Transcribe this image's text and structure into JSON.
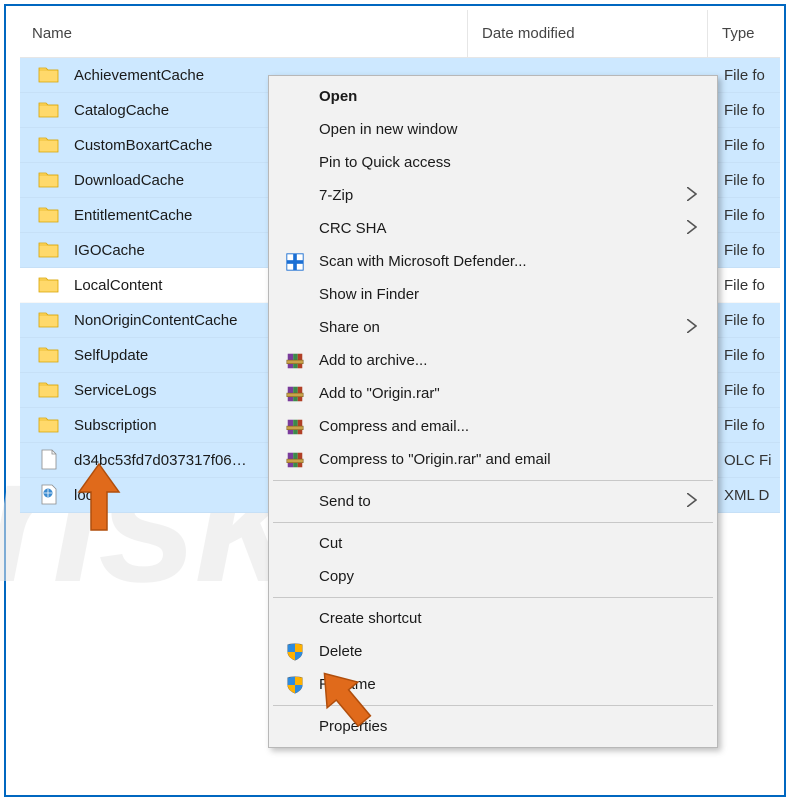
{
  "watermark": "risk.com",
  "headers": {
    "name": "Name",
    "date": "Date modified",
    "type": "Type"
  },
  "rows": [
    {
      "name": "AchievementCache",
      "icon": "folder",
      "sel": true,
      "date": "",
      "type": "File fo"
    },
    {
      "name": "CatalogCache",
      "icon": "folder",
      "sel": true,
      "date": "",
      "type": "File fo"
    },
    {
      "name": "CustomBoxartCache",
      "icon": "folder",
      "sel": true,
      "date": "",
      "type": "File fo"
    },
    {
      "name": "DownloadCache",
      "icon": "folder",
      "sel": true,
      "date": "",
      "type": "File fo"
    },
    {
      "name": "EntitlementCache",
      "icon": "folder",
      "sel": true,
      "date": "",
      "type": "File fo"
    },
    {
      "name": "IGOCache",
      "icon": "folder",
      "sel": true,
      "date": "",
      "type": "File fo"
    },
    {
      "name": "LocalContent",
      "icon": "folder",
      "sel": false,
      "date": "",
      "type": "File fo"
    },
    {
      "name": "NonOriginContentCache",
      "icon": "folder",
      "sel": true,
      "date": "",
      "type": "File fo"
    },
    {
      "name": "SelfUpdate",
      "icon": "folder",
      "sel": true,
      "date": "",
      "type": "File fo"
    },
    {
      "name": "ServiceLogs",
      "icon": "folder",
      "sel": true,
      "date": "",
      "type": "File fo"
    },
    {
      "name": "Subscription",
      "icon": "folder",
      "sel": true,
      "date": "",
      "type": "File fo"
    },
    {
      "name": "d34bc53fd7d037317f06…",
      "icon": "file",
      "sel": true,
      "date": "",
      "type": "OLC Fi"
    },
    {
      "name": "local",
      "icon": "xml",
      "sel": true,
      "date": "",
      "type": "XML D"
    }
  ],
  "menu": [
    {
      "kind": "item",
      "label": "Open",
      "icon": "",
      "bold": true
    },
    {
      "kind": "item",
      "label": "Open in new window",
      "icon": ""
    },
    {
      "kind": "item",
      "label": "Pin to Quick access",
      "icon": ""
    },
    {
      "kind": "item",
      "label": "7-Zip",
      "icon": "",
      "sub": true
    },
    {
      "kind": "item",
      "label": "CRC SHA",
      "icon": "",
      "sub": true
    },
    {
      "kind": "item",
      "label": "Scan with Microsoft Defender...",
      "icon": "shield-blue"
    },
    {
      "kind": "item",
      "label": "Show in Finder",
      "icon": ""
    },
    {
      "kind": "item",
      "label": "Share on",
      "icon": "",
      "sub": true
    },
    {
      "kind": "item",
      "label": "Add to archive...",
      "icon": "winrar"
    },
    {
      "kind": "item",
      "label": "Add to \"Origin.rar\"",
      "icon": "winrar"
    },
    {
      "kind": "item",
      "label": "Compress and email...",
      "icon": "winrar"
    },
    {
      "kind": "item",
      "label": "Compress to \"Origin.rar\" and email",
      "icon": "winrar"
    },
    {
      "kind": "sep"
    },
    {
      "kind": "item",
      "label": "Send to",
      "icon": "",
      "sub": true
    },
    {
      "kind": "sep"
    },
    {
      "kind": "item",
      "label": "Cut",
      "icon": ""
    },
    {
      "kind": "item",
      "label": "Copy",
      "icon": ""
    },
    {
      "kind": "sep"
    },
    {
      "kind": "item",
      "label": "Create shortcut",
      "icon": ""
    },
    {
      "kind": "item",
      "label": "Delete",
      "icon": "shield-uac"
    },
    {
      "kind": "item",
      "label": "Rename",
      "icon": "shield-uac"
    },
    {
      "kind": "sep"
    },
    {
      "kind": "item",
      "label": "Properties",
      "icon": ""
    }
  ]
}
